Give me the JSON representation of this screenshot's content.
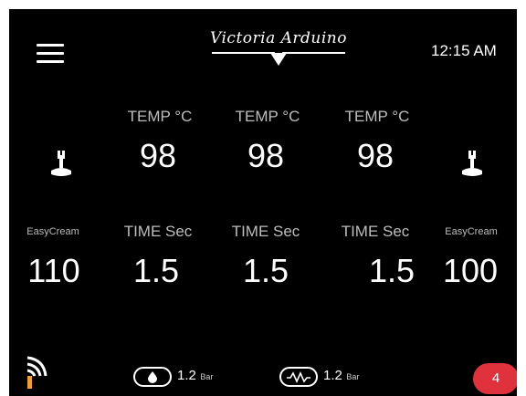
{
  "header": {
    "menu_icon": "hamburger-menu-icon",
    "logo_text": "Victoria Arduino",
    "time": "12:15 AM"
  },
  "groups": [
    {
      "temp_label": "TEMP °C",
      "temp_value": "98",
      "time_label": "TIME Sec",
      "time_value": "1.5"
    },
    {
      "temp_label": "TEMP °C",
      "temp_value": "98",
      "time_label": "TIME Sec",
      "time_value": "1.5"
    },
    {
      "temp_label": "TEMP °C",
      "temp_value": "98",
      "time_label": "TIME Sec",
      "time_value": "1.5"
    }
  ],
  "left_steam": {
    "icon": "steam-wand-icon",
    "label": "EasyCream",
    "value": "110"
  },
  "right_steam": {
    "icon": "steam-wand-icon",
    "label": "EasyCream",
    "value": "100"
  },
  "footer": {
    "wifi_icon": "wifi-signal-icon",
    "boiler_pressure": {
      "icon": "drop-icon",
      "value": "1.2",
      "unit": "Bar"
    },
    "pump_pressure": {
      "icon": "wave-icon",
      "value": "1.2",
      "unit": "Bar"
    },
    "notification_count": "4"
  },
  "colors": {
    "background": "#000000",
    "accent": "#e0323c",
    "label": "#bdbdbd"
  }
}
